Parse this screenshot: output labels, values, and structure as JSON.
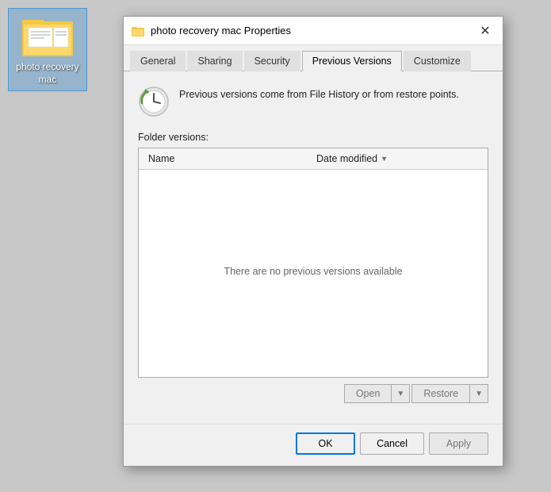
{
  "desktop": {
    "background_color": "#c8c8c8"
  },
  "folder_icon": {
    "label_line1": "photo recovery",
    "label_line2": "mac"
  },
  "dialog": {
    "title": "photo recovery mac Properties",
    "close_label": "✕",
    "tabs": [
      {
        "id": "general",
        "label": "General",
        "active": false
      },
      {
        "id": "sharing",
        "label": "Sharing",
        "active": false
      },
      {
        "id": "security",
        "label": "Security",
        "active": false
      },
      {
        "id": "previous-versions",
        "label": "Previous Versions",
        "active": true
      },
      {
        "id": "customize",
        "label": "Customize",
        "active": false
      }
    ],
    "info_text": "Previous versions come from File History or from restore points.",
    "folder_versions_label": "Folder versions:",
    "table": {
      "columns": [
        {
          "id": "name",
          "label": "Name"
        },
        {
          "id": "date-modified",
          "label": "Date modified"
        }
      ],
      "empty_message": "There are no previous versions available"
    },
    "version_buttons": {
      "open_label": "Open",
      "restore_label": "Restore"
    },
    "footer_buttons": {
      "ok_label": "OK",
      "cancel_label": "Cancel",
      "apply_label": "Apply"
    }
  }
}
